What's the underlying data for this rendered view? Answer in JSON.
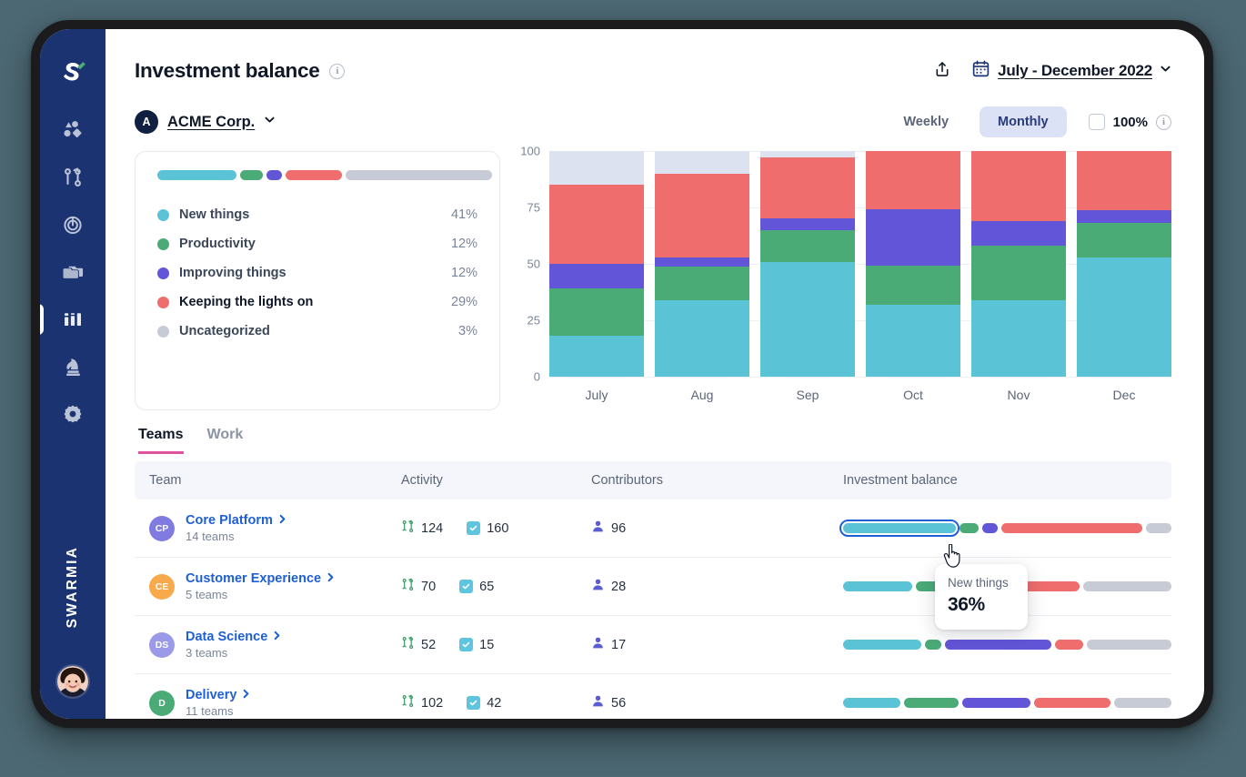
{
  "app": {
    "brand": "SWARMIA",
    "sidebar_items": [
      {
        "name": "logo",
        "icon": "swarmia-logo-icon",
        "active": false
      },
      {
        "name": "insights",
        "icon": "shapes-icon",
        "active": false
      },
      {
        "name": "pull-requests",
        "icon": "branch-icon",
        "active": false
      },
      {
        "name": "goals",
        "icon": "target-icon",
        "active": false
      },
      {
        "name": "projects",
        "icon": "folders-icon",
        "active": false
      },
      {
        "name": "investment-balance",
        "icon": "columns-icon",
        "active": true
      },
      {
        "name": "strategy",
        "icon": "knight-icon",
        "active": false
      },
      {
        "name": "settings",
        "icon": "gear-icon",
        "active": false
      }
    ]
  },
  "header": {
    "title": "Investment balance",
    "info_icon": "info-icon",
    "share_icon": "share-icon",
    "calendar_icon": "calendar-icon",
    "date_range": "July - December 2022",
    "chevron_icon": "chevron-down-icon"
  },
  "sub_header": {
    "org_initial": "A",
    "org_name": "ACME Corp.",
    "granularity": {
      "options": [
        "Weekly",
        "Monthly"
      ],
      "selected": "Monthly"
    },
    "percent_toggle": {
      "label": "100%",
      "checked": false,
      "info_icon": "info-icon"
    }
  },
  "legend": {
    "items": [
      {
        "label": "New things",
        "value": "41%",
        "color": "#5bc3d6",
        "emphasis": false
      },
      {
        "label": "Productivity",
        "value": "12%",
        "color": "#4aab77",
        "emphasis": false
      },
      {
        "label": "Improving things",
        "value": "12%",
        "color": "#6355d8",
        "emphasis": false
      },
      {
        "label": "Keeping the lights on",
        "value": "29%",
        "color": "#ef6d6d",
        "emphasis": true
      },
      {
        "label": "Uncategorized",
        "value": "3%",
        "color": "#c6cbd6",
        "emphasis": false
      }
    ],
    "bar_segments": [
      41,
      12,
      8,
      29,
      76
    ]
  },
  "chart_data": {
    "type": "bar",
    "stacked": true,
    "title": "Investment balance",
    "xlabel": "",
    "ylabel": "",
    "ylim": [
      0,
      100
    ],
    "yticks": [
      0,
      25,
      50,
      75,
      100
    ],
    "grid": true,
    "legend_position": "left-card",
    "categories": [
      "July",
      "Aug",
      "Sep",
      "Oct",
      "Nov",
      "Dec"
    ],
    "series": [
      {
        "name": "New things",
        "color": "#5bc3d6",
        "values": [
          18,
          34,
          51,
          32,
          34,
          53
        ]
      },
      {
        "name": "Productivity",
        "color": "#4aab77",
        "values": [
          21,
          15,
          14,
          17,
          24,
          15
        ]
      },
      {
        "name": "Improving things",
        "color": "#6355d8",
        "values": [
          11,
          4,
          5,
          25,
          11,
          6
        ]
      },
      {
        "name": "Keeping the lights on",
        "color": "#ef6d6d",
        "values": [
          35,
          37,
          27,
          26,
          31,
          26
        ]
      },
      {
        "name": "Uncategorized",
        "color": "#dde2f0",
        "values": [
          15,
          10,
          3,
          0,
          0,
          0
        ]
      }
    ]
  },
  "tabs": [
    {
      "label": "Teams",
      "active": true
    },
    {
      "label": "Work",
      "active": false
    }
  ],
  "table": {
    "columns": [
      "Team",
      "Activity",
      "Contributors",
      "Investment balance"
    ],
    "rows": [
      {
        "initials": "CP",
        "avatar_color": "#7f7be0",
        "name": "Core Platform",
        "sub": "14 teams",
        "pull_requests": "124",
        "tasks": "160",
        "contributors": "96",
        "balance": [
          36,
          6,
          5,
          45,
          8
        ],
        "highlight_index": 0
      },
      {
        "initials": "CE",
        "avatar_color": "#f7a94b",
        "name": "Customer Experience",
        "sub": "5 teams",
        "pull_requests": "70",
        "tasks": "65",
        "contributors": "28",
        "balance": [
          22,
          11,
          18,
          21,
          28
        ],
        "highlight_index": -1
      },
      {
        "initials": "DS",
        "avatar_color": "#9a9ae8",
        "name": "Data Science",
        "sub": "3 teams",
        "pull_requests": "52",
        "tasks": "15",
        "contributors": "17",
        "balance": [
          25,
          5,
          34,
          9,
          27
        ],
        "highlight_index": -1
      },
      {
        "initials": "D",
        "avatar_color": "#4aab77",
        "name": "Delivery",
        "sub": "11 teams",
        "pull_requests": "102",
        "tasks": "42",
        "contributors": "56",
        "balance": [
          21,
          20,
          25,
          28,
          21
        ],
        "highlight_index": -1
      }
    ],
    "icons": {
      "pull_request": "pull-request-icon",
      "task": "checkbox-checked-icon",
      "contributor": "person-icon",
      "chevron": "chevron-right-icon"
    }
  },
  "tooltip": {
    "label": "New things",
    "value": "36%"
  },
  "colors": {
    "new_things": "#5bc3d6",
    "productivity": "#4aab77",
    "improving_things": "#6355d8",
    "keeping_lights_on": "#ef6d6d",
    "uncategorized": "#c6cbd6",
    "uncategorized_chart": "#dde2f0",
    "accent_tab": "#e0529c",
    "link": "#1f5fd6",
    "sidebar": "#1b3370",
    "page_background": "#4c6873"
  }
}
